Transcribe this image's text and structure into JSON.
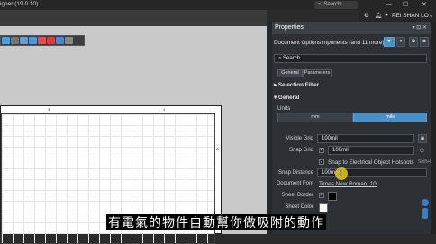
{
  "window": {
    "title": "igner (19.0.10)",
    "search_label": "Search",
    "user": "PEI SHAN LO"
  },
  "panel": {
    "title": "Properties",
    "doc_options_label": "Document Options",
    "doc_options_value": "mponents (and 11 more)",
    "search_placeholder": "Search",
    "tabs": [
      "General",
      "Parameters"
    ],
    "sections": {
      "selection_filter": "Selection Filter",
      "general": "General"
    },
    "units": {
      "label": "Units",
      "mm": "mm",
      "mils": "mils"
    },
    "visible_grid": {
      "label": "Visible Grid",
      "value": "100mil"
    },
    "snap_grid": {
      "label": "Snap Grid",
      "value": "100mil",
      "shortcut": "G"
    },
    "snap_hotspots": {
      "label": "Snap to Electrical Object Hotspots",
      "shortcut": "Shift+E"
    },
    "snap_distance": {
      "label": "Snap Distance",
      "value": "100mil"
    },
    "document_font": {
      "label": "Document Font",
      "value": "Times New Roman, 10"
    },
    "sheet_border": {
      "label": "Sheet Border"
    },
    "sheet_color": {
      "label": "Sheet Color"
    }
  },
  "ruler": {
    "a": "3",
    "b": "4",
    "side": "A"
  },
  "subtitle": "有電氣的物件自動幫你做吸附的動作",
  "colors": {
    "accent": "#4a90c8",
    "subtitle_bg": "#000000",
    "cursor": "#e6c81e"
  }
}
